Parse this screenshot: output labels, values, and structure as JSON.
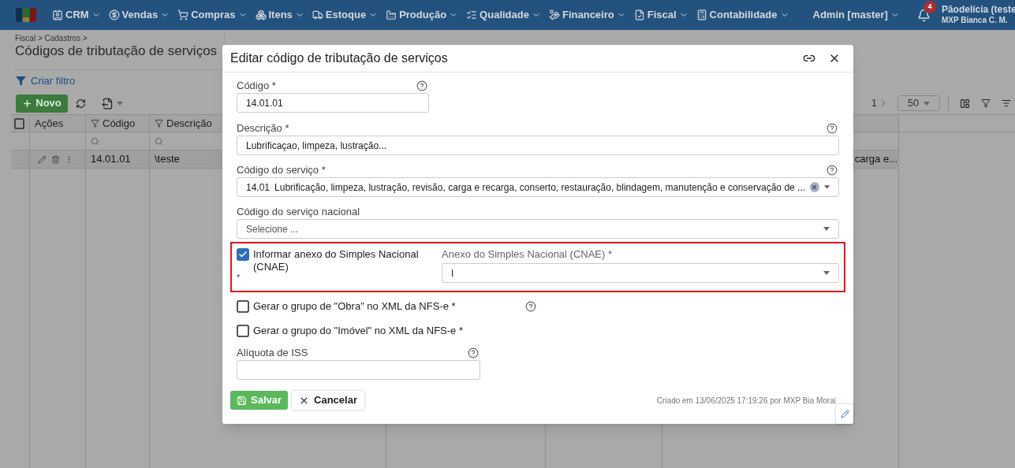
{
  "navbar": {
    "menus": [
      {
        "label": "CRM"
      },
      {
        "label": "Vendas"
      },
      {
        "label": "Compras"
      },
      {
        "label": "Itens"
      },
      {
        "label": "Estoque"
      },
      {
        "label": "Produção"
      },
      {
        "label": "Qualidade"
      },
      {
        "label": "Financeiro"
      },
      {
        "label": "Fiscal"
      },
      {
        "label": "Contabilidade"
      }
    ],
    "user": "Admin [master]",
    "notifications": "4",
    "company": "Pãodelícia (teste",
    "company_user": "MXP Bianca C. M."
  },
  "page": {
    "breadcrumb": "Fiscal > Cadastros >",
    "title": "Códigos de tributação de serviços",
    "filter_link": "Criar filtro",
    "new_button": "Novo",
    "pagination": {
      "page": "1",
      "page_size": "50"
    },
    "table": {
      "select_all_checked": false,
      "columns": [
        "Ações",
        "Código",
        "Descrição"
      ],
      "rows": [
        {
          "codigo": "14.01.01",
          "descricao": "\\teste",
          "column_7": "carga e..."
        }
      ]
    }
  },
  "dialog": {
    "title": "Editar código de tributação de serviços",
    "codigo": {
      "label": "Código *",
      "value": "14.01.01",
      "help": true
    },
    "descricao": {
      "label": "Descrição *",
      "value": "Lubrificaçao, limpeza, lustração...",
      "help": true
    },
    "codigo_servico": {
      "label": "Código do serviço *",
      "code": "14.01",
      "value": "Lubrificação, limpeza, lustração, revisão, carga e recarga, conserto, restauração, blindagem, manutenção e conservação de ...",
      "help": true,
      "clearable": true
    },
    "codigo_servico_nacional": {
      "label": "Código do serviço nacional",
      "placeholder": "Selecione ..."
    },
    "simples": {
      "label": "Informar anexo do Simples Nacional (CNAE)",
      "required_mark": "*",
      "checked": true,
      "anexo": {
        "label": "Anexo do Simples Nacional (CNAE) *",
        "value": "I"
      }
    },
    "obra": {
      "label": "Gerar o grupo de \"Obra\" no XML da NFS-e *",
      "checked": false,
      "help": true
    },
    "imovel": {
      "label": "Gerar o grupo do \"Imóvel\" no XML da NFS-e *",
      "checked": false,
      "help": false
    },
    "aliquota": {
      "label": "Alíquota de ISS",
      "help": true
    },
    "save_button": "Salvar",
    "cancel_button": "Cancelar",
    "footer": "Criado em 13/06/2025 17:19:26 por MXP Bia Morai"
  }
}
